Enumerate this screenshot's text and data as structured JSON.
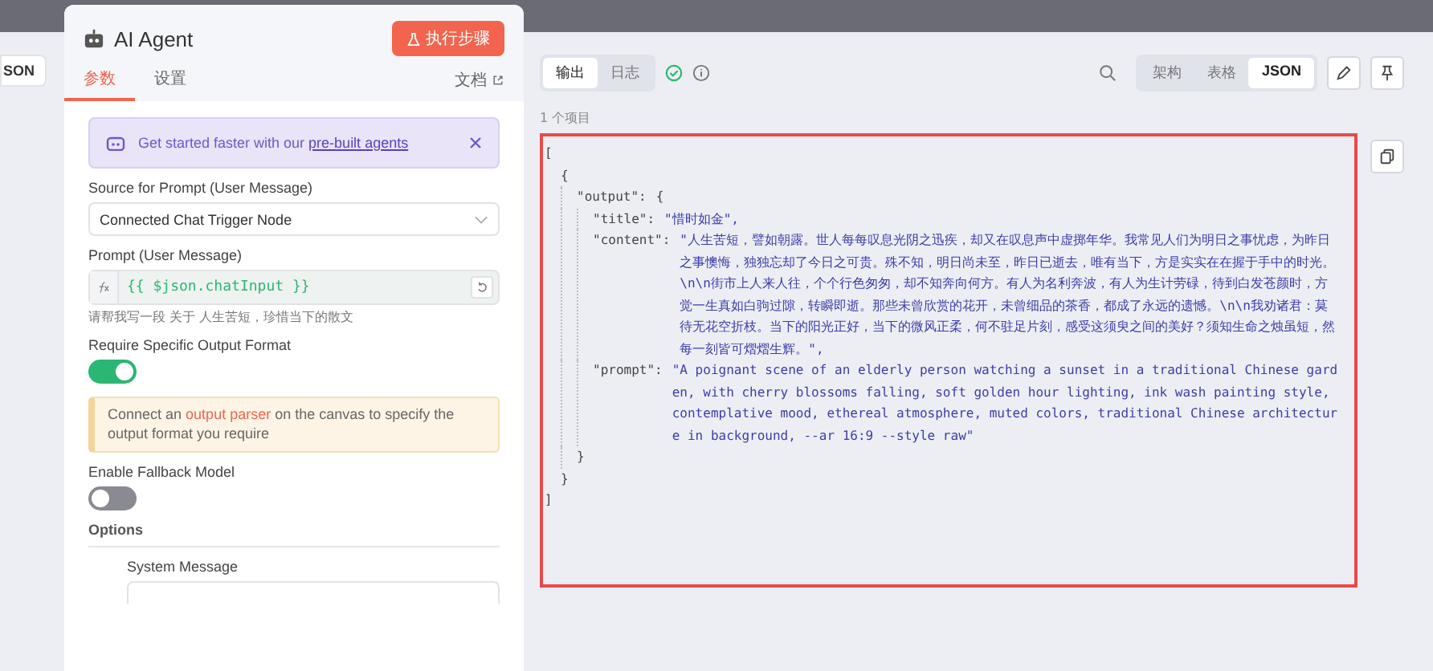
{
  "left_pane": {
    "view_button": "SON"
  },
  "node_panel": {
    "title": "AI Agent",
    "run_button": "执行步骤",
    "tabs": [
      {
        "label": "参数",
        "selected": true
      },
      {
        "label": "设置",
        "selected": false
      }
    ],
    "docs_link": "文档",
    "banner": {
      "text": "Get started faster with our ",
      "link": "pre-built agents"
    },
    "fields": [
      {
        "kind": "select",
        "label": "Source for Prompt (User Message)",
        "value": "Connected Chat Trigger Node"
      },
      {
        "kind": "expression",
        "label": "Prompt (User Message)",
        "value": "{{ $json.chatInput }}",
        "hint": "请帮我写一段 关于 人生苦短，珍惜当下的散文"
      },
      {
        "kind": "toggle",
        "label": "Require Specific Output Format",
        "on": true
      },
      {
        "kind": "notice",
        "text": "Connect an **output parser** on the canvas to specify the output format you require"
      },
      {
        "kind": "toggle",
        "label": "Enable Fallback Model",
        "on": false
      },
      {
        "kind": "section",
        "label": "Options"
      },
      {
        "kind": "textarea",
        "label": "System Message"
      }
    ]
  },
  "output_pane": {
    "tabs": [
      {
        "label": "输出",
        "selected": true
      },
      {
        "label": "日志",
        "selected": false
      }
    ],
    "views": [
      {
        "label": "架构",
        "selected": false
      },
      {
        "label": "表格",
        "selected": false
      },
      {
        "label": "JSON",
        "selected": true
      }
    ],
    "item_count": "1 个项目",
    "json_tree": {
      "open": "[",
      "close": "]",
      "children": [
        {
          "open": "{",
          "close": "}",
          "children": [
            {
              "key": "\"output\":",
              "open": "{",
              "close": "}",
              "children": [
                {
                  "key": "\"title\":",
                  "value": "\"惜时如金\","
                },
                {
                  "key": "\"content\":",
                  "value": "\"人生苦短，譬如朝露。世人每每叹息光阴之迅疾，却又在叹息声中虚掷年华。我常见人们为明日之事忧虑，为昨日之事懊悔，独独忘却了今日之可贵。殊不知，明日尚未至，昨日已逝去，唯有当下，方是实实在在握于手中的时光。\\n\\n街市上人来人往，个个行色匆匆，却不知奔向何方。有人为名利奔波，有人为生计劳碌，待到白发苍颜时，方觉一生真如白驹过隙，转瞬即逝。那些未曾欣赏的花开，未曾细品的茶香，都成了永远的遗憾。\\n\\n我劝诸君：莫待无花空折枝。当下的阳光正好，当下的微风正柔，何不驻足片刻，感受这须臾之间的美好？须知生命之烛虽短，然每一刻皆可熠熠生辉。\","
                },
                {
                  "key": "\"prompt\":",
                  "value": "\"A poignant scene of an elderly person watching a sunset in a traditional Chinese garden, with cherry blossoms falling, soft golden hour lighting, ink wash painting style, contemplative mood, ethereal atmosphere, muted colors, traditional Chinese architecture in background, --ar 16:9 --style raw\""
                }
              ]
            }
          ]
        }
      ]
    }
  }
}
